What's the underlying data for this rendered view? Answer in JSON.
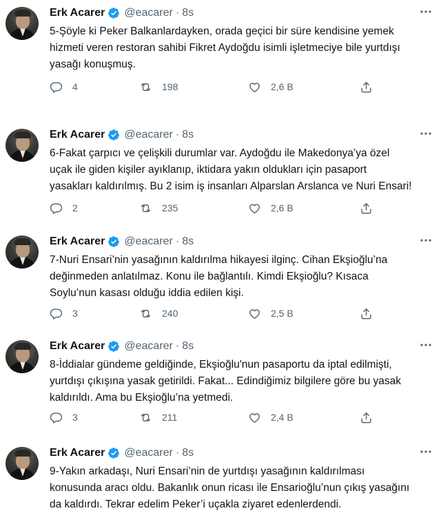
{
  "colors": {
    "text": "#0f1419",
    "secondary": "#536471",
    "verified": "#1d9bf0"
  },
  "icons": {
    "reply": "reply-icon",
    "retweet": "retweet-icon",
    "like": "heart-icon",
    "share": "share-icon",
    "verified": "verified-badge-icon",
    "more": "more-dots-icon"
  },
  "tweets": [
    {
      "name": "Erk Acarer",
      "handle": "@eacarer",
      "separator": "·",
      "time": "8s",
      "text": "5-Şöyle ki Peker Balkanlardayken, orada geçici bir süre kendisine yemek\nhizmeti veren restoran sahibi Fikret Aydoğdu isimli işletmeciye bile yurtdışı\nyasağı konuşmuş.",
      "replies": "4",
      "retweets": "198",
      "likes": "2,6 B"
    },
    {
      "name": "Erk Acarer",
      "handle": "@eacarer",
      "separator": "·",
      "time": "8s",
      "text": "6-Fakat çarpıcı ve çelişkili durumlar var. Aydoğdu ile Makedonya’ya özel\nuçak ile giden kişiler ayıklanıp, iktidara yakın oldukları için pasaport\nyasakları kaldırılmış. Bu 2 isim iş insanları Alparslan Arslanca ve Nuri Ensari!",
      "replies": "2",
      "retweets": "235",
      "likes": "2,6 B"
    },
    {
      "name": "Erk Acarer",
      "handle": "@eacarer",
      "separator": "·",
      "time": "8s",
      "text": "7-Nuri Ensari’nin yasağının kaldırılma hikayesi ilginç. Cihan Ekşioğlu’na\ndeğinmeden anlatılmaz. Konu ile bağlantılı. Kimdi Ekşioğlu? Kısaca\nSoylu’nun kasası olduğu iddia edilen kişi.",
      "replies": "3",
      "retweets": "240",
      "likes": "2,5 B"
    },
    {
      "name": "Erk Acarer",
      "handle": "@eacarer",
      "separator": "·",
      "time": "8s",
      "text": "8-İddialar gündeme geldiğinde, Ekşioğlu'nun pasaportu da iptal edilmişti,\nyurtdışı çıkışına yasak getirildi. Fakat... Edindiğimiz bilgilere göre bu yasak\nkaldırıldı. Ama bu Ekşioğlu’na yetmedi.",
      "replies": "3",
      "retweets": "211",
      "likes": "2,4 B"
    },
    {
      "name": "Erk Acarer",
      "handle": "@eacarer",
      "separator": "·",
      "time": "8s",
      "text": "9-Yakın arkadaşı, Nuri Ensari’nin de yurtdışı yasağının kaldırılması\nkonusunda aracı oldu. Bakanlık onun ricası ile Ensarioğlu’nun çıkış yasağını\nda kaldırdı. Tekrar edelim Peker’i uçakla ziyaret edenlerdendi."
    }
  ]
}
